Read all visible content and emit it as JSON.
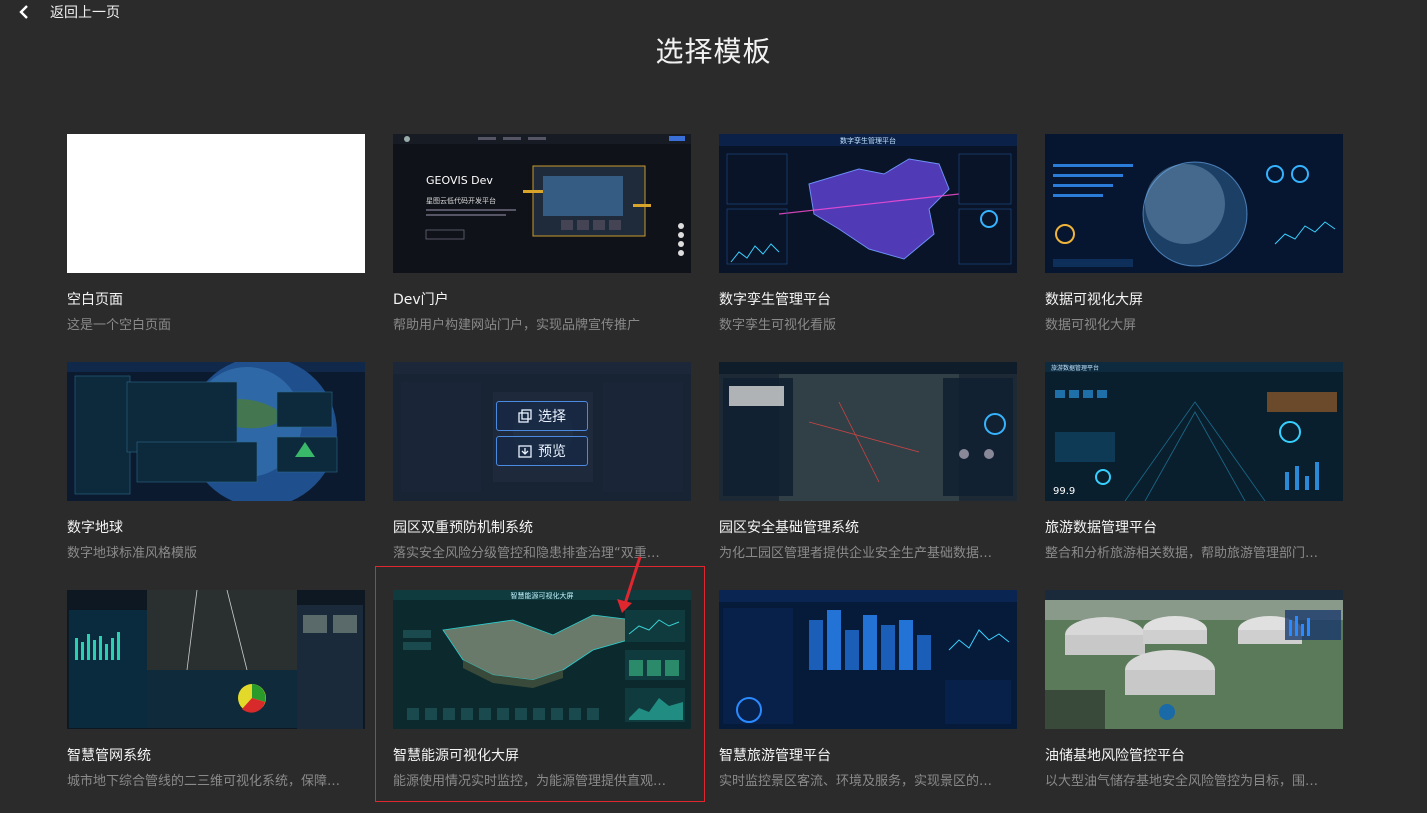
{
  "header": {
    "back_label": "返回上一页",
    "title": "选择模板"
  },
  "overlay": {
    "select_label": "选择",
    "preview_label": "预览"
  },
  "thumbnail_text": {
    "geovis_title": "GEOVIS Dev",
    "geovis_subtitle": "星图云低代码开发平台",
    "twin_title": "数字孪生管理平台",
    "energy_title": "智慧能源可视化大屏",
    "tour_title": "旅游数据管理平台",
    "tour_big": "99.9"
  },
  "templates": [
    {
      "name": "空白页面",
      "desc": "这是一个空白页面"
    },
    {
      "name": "Dev门户",
      "desc": "帮助用户构建网站门户，实现品牌宣传推广"
    },
    {
      "name": "数字孪生管理平台",
      "desc": "数字孪生可视化看版"
    },
    {
      "name": "数据可视化大屏",
      "desc": "数据可视化大屏"
    },
    {
      "name": "数字地球",
      "desc": "数字地球标准风格模版"
    },
    {
      "name": "园区双重预防机制系统",
      "desc": "落实安全风险分级管控和隐患排查治理“双重…"
    },
    {
      "name": "园区安全基础管理系统",
      "desc": "为化工园区管理者提供企业安全生产基础数据…"
    },
    {
      "name": "旅游数据管理平台",
      "desc": "整合和分析旅游相关数据，帮助旅游管理部门…"
    },
    {
      "name": "智慧管网系统",
      "desc": "城市地下综合管线的二三维可视化系统，保障…"
    },
    {
      "name": "智慧能源可视化大屏",
      "desc": "能源使用情况实时监控，为能源管理提供直观…"
    },
    {
      "name": "智慧旅游管理平台",
      "desc": "实时监控景区客流、环境及服务，实现景区的…"
    },
    {
      "name": "油储基地风险管控平台",
      "desc": "以大型油气储存基地安全风险管控为目标，围…"
    }
  ],
  "colors": {
    "background": "#2b2b2b",
    "highlight": "#e0262e",
    "button_border": "#4a8be0"
  }
}
